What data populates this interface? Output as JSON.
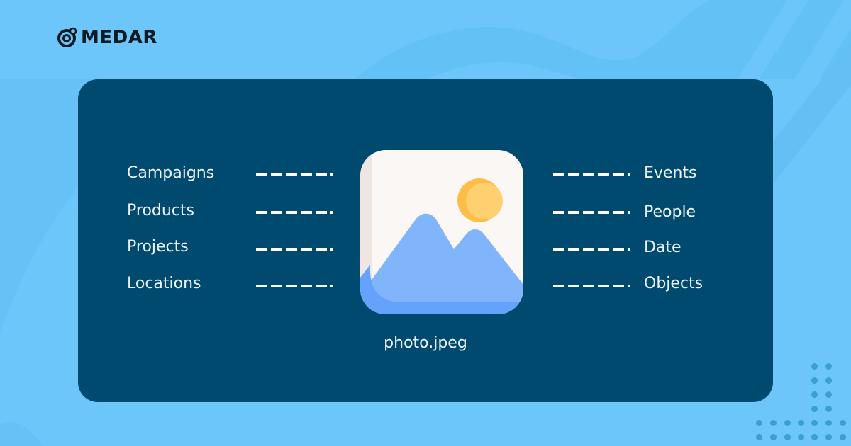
{
  "brand": {
    "name": "MEDAR",
    "logo_icon": "camera-lens-logo-icon"
  },
  "left_labels": [
    {
      "label": "Campaigns"
    },
    {
      "label": "Products"
    },
    {
      "label": "Projects"
    },
    {
      "label": "Locations"
    }
  ],
  "right_labels": [
    {
      "label": "Events"
    },
    {
      "label": "People"
    },
    {
      "label": "Date"
    },
    {
      "label": "Objects"
    }
  ],
  "center": {
    "icon": "image-icon",
    "filename": "photo.jpeg"
  },
  "colors": {
    "background": "#6cc6fa",
    "card": "#004a70",
    "text": "#eef4f8",
    "sun": "#ffd06f",
    "mountain": "#80b4fb"
  }
}
